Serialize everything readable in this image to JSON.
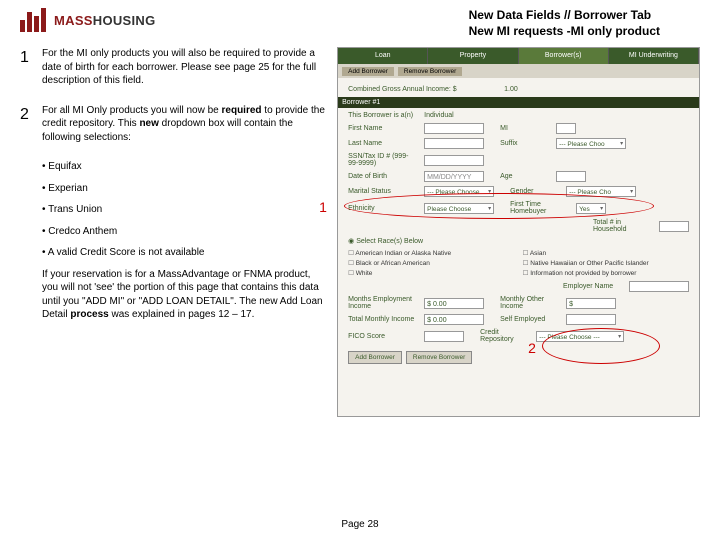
{
  "header": {
    "logo_mass": "MASS",
    "logo_housing": "HOUSING",
    "title_line1": "New Data Fields // Borrower Tab",
    "title_line2": "New MI requests -MI only product"
  },
  "steps": {
    "n1": "1",
    "n2": "2",
    "p1": "For the MI only products you will also be required to provide a date of birth for each borrower.  Please see page 25 for the full description of this field.",
    "p2a": "For all MI Only products you will now be ",
    "p2_req": "required",
    "p2b": " to provide the credit repository.  This ",
    "p2_new": "new",
    "p2c": " dropdown box will contain the following selections:",
    "b1": "Equifax",
    "b2": "Experian",
    "b3": "Trans Union",
    "b4": "Credco Anthem",
    "b5": "A valid Credit Score is not available",
    "p3a": "If your reservation is for a MassAdvantage or FNMA product, you will not 'see' the portion of this page that contains this data until you \"ADD MI\" or \"ADD LOAN DETAIL\".  The new Add Loan Detail ",
    "p3_proc": "process",
    "p3b": " was explained in pages 12 – 17."
  },
  "shot": {
    "tabs": {
      "t1": "Loan",
      "t2": "Property",
      "t3": "Borrower(s)",
      "t4": "MI Underwriting"
    },
    "sub": {
      "s1": "Add Borrower",
      "s2": "Remove Borrower"
    },
    "income_lbl": "Combined Gross Annual Income: $",
    "income_val": "1.00",
    "borrower_hdr": "Borrower #1",
    "r_this": "This Borrower is a(n)",
    "r_this_v": "Individual",
    "r_first": "First Name",
    "r_mi": "MI",
    "r_last": "Last Name",
    "r_suf": "Suffix",
    "r_suf_v": "--- Please Choo",
    "r_ssn": "SSN/Tax ID # (999-99-9999)",
    "r_dob": "Date of Birth",
    "r_dob_ph": "MM/DD/YYYY",
    "r_age": "Age",
    "r_mar": "Marital Status",
    "r_mar_v": "--- Please Choose",
    "r_gen": "Gender",
    "r_gen_v": "--- Please Cho",
    "r_eth": "Ethnicity",
    "r_eth_v": "Please Choose",
    "r_fthb": "First Time Homebuyer",
    "r_fthb_v": "Yes",
    "r_hh": "Total # in Household",
    "r_race": "Select Race(s) Below",
    "c1": "American Indian or Alaska Native",
    "c2": "Asian",
    "c3": "Black or African American",
    "c4": "Native Hawaiian or Other Pacific Islander",
    "c5": "White",
    "c6": "Information not provided by borrower",
    "r_emp": "Employer Name",
    "r_mei": "Months Employment Income",
    "r_mei_v": "$ 0.00",
    "r_moi": "Monthly Other Income",
    "r_moi_v": "$",
    "r_tmi": "Total Monthly Income",
    "r_tmi_v": "$ 0.00",
    "r_self": "Self Employed",
    "r_fico": "FICO Score",
    "r_cr": "Credit Repository",
    "r_cr_v": "--- Please Choose ---",
    "btn_add": "Add Borrower",
    "btn_rem": "Remove Borrower"
  },
  "callouts": {
    "c1": "1",
    "c2": "2"
  },
  "footer": "Page 28"
}
